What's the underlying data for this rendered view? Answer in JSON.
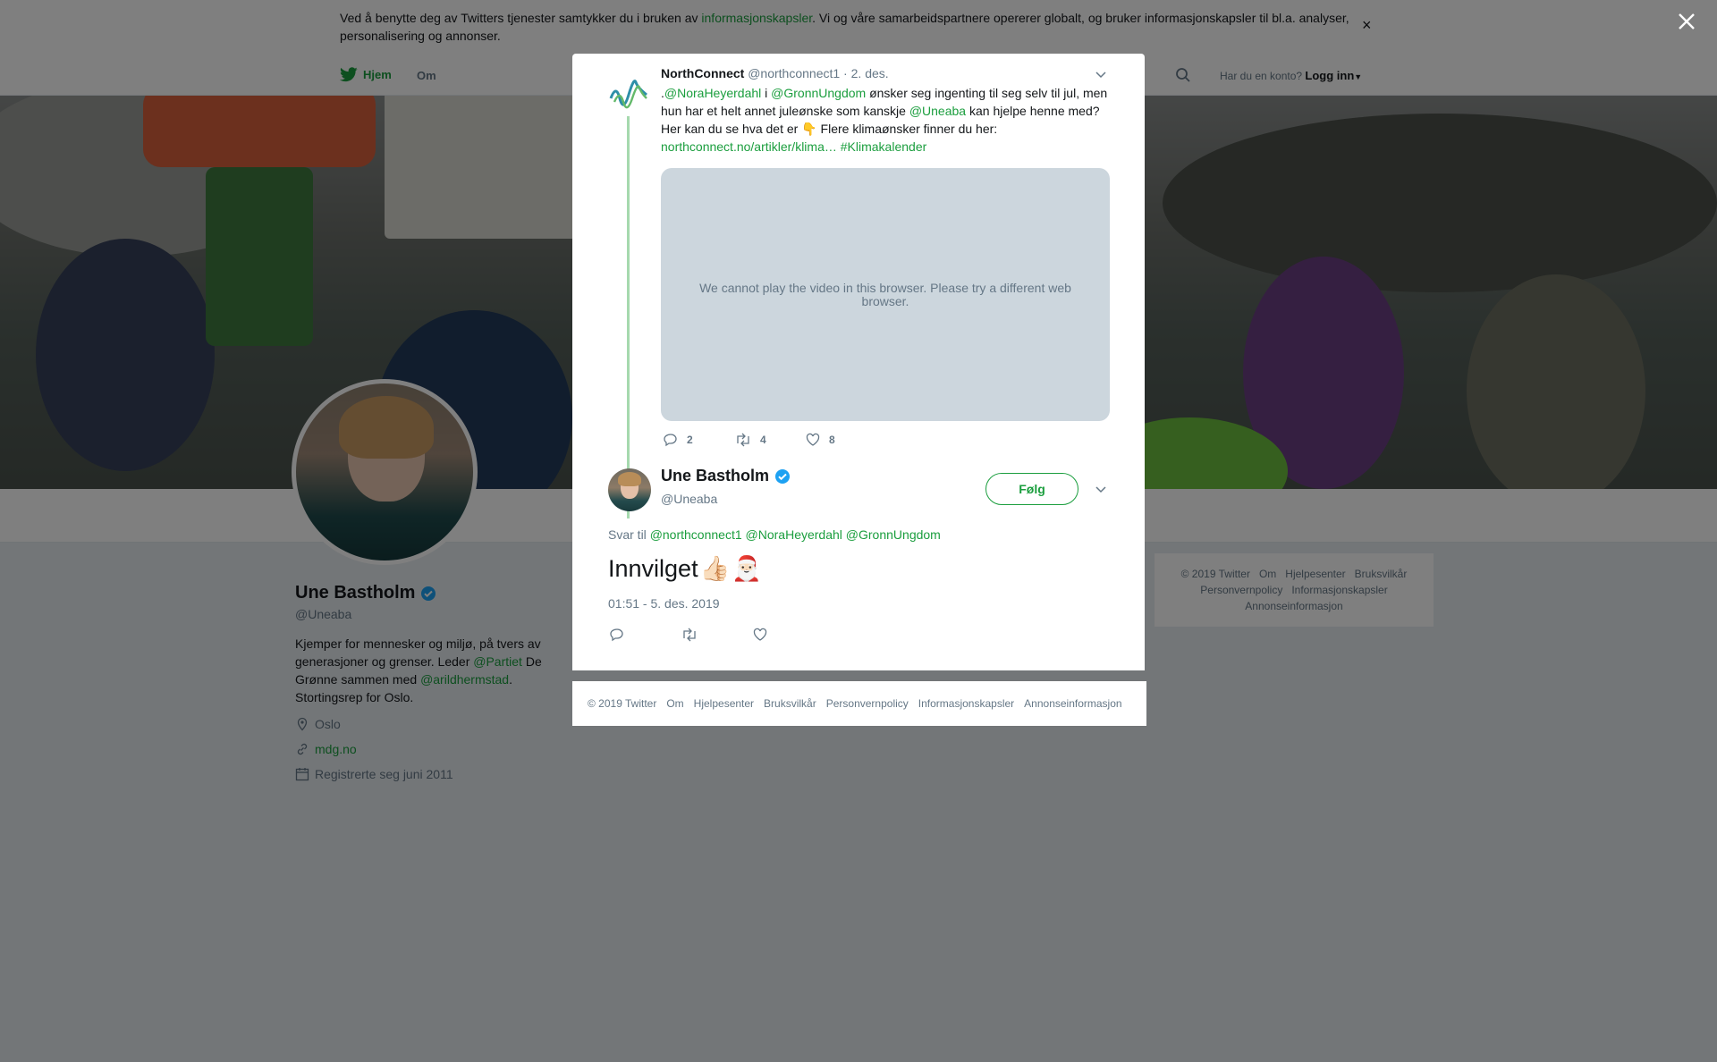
{
  "cookie": {
    "pre": "Ved å benytte deg av Twitters tjenester samtykker du i bruken av ",
    "link": "informasjonskapsler",
    "post": ". Vi og våre samarbeidspartnere opererer globalt, og bruker informasjonskapsler til bl.a. analyser, personalisering og annonser.",
    "close": "×"
  },
  "nav": {
    "home": "Hjem",
    "about": "Om",
    "account_prompt": "Har du en konto?",
    "login": "Logg inn"
  },
  "profile": {
    "name": "Une Bastholm",
    "handle": "@Uneaba",
    "bio_1": "Kjemper for mennesker og miljø, på tvers av generasjoner og grenser. Leder ",
    "bio_link_1": "@Partiet",
    "bio_2": " De Grønne sammen med ",
    "bio_link_2": "@arildhermstad",
    "bio_3": ". Stortingsrep for Oslo.",
    "location": "Oslo",
    "website": "mdg.no",
    "joined": "Registrerte seg juni 2011"
  },
  "right_footer": {
    "items": [
      "© 2019 Twitter",
      "Om",
      "Hjelpesenter",
      "Bruksvilkår",
      "Personvernpolicy",
      "Informasjonskapsler",
      "Annonseinformasjon"
    ]
  },
  "parent_tweet": {
    "name": "NorthConnect",
    "handle": "@northconnect1",
    "sep": " · ",
    "date": "2. des.",
    "t_dot": ".",
    "m1": "@NoraHeyerdahl",
    "t_i": " i ",
    "m2": "@GronnUngdom",
    "t_a": " ønsker seg ingenting til seg selv til jul, men hun har et helt annet juleønske som kanskje ",
    "m3": "@Uneaba",
    "t_b": " kan hjelpe henne med? Her kan du se hva det er ",
    "emoji": "👇",
    "t_c": " Flere klimaønsker finner du her: ",
    "url": "northconnect.no/artikler/klima…",
    "hashtag": "#Klimakalender",
    "video_message": "We cannot play the video in this browser. Please try a different web browser.",
    "replies": "2",
    "retweets": "4",
    "likes": "8"
  },
  "reply_tweet": {
    "name": "Une Bastholm",
    "handle": "@Uneaba",
    "follow": "Følg",
    "reply_to_label": "Svar til",
    "reply_mentions": [
      "@northconnect1",
      "@NoraHeyerdahl",
      "@GronnUngdom"
    ],
    "text": "Innvilget",
    "emoji_1": "👍🏻",
    "emoji_2": "🎅🏻",
    "timestamp": "01:51 - 5. des. 2019"
  },
  "modal_footer": {
    "items": [
      "© 2019 Twitter",
      "Om",
      "Hjelpesenter",
      "Bruksvilkår",
      "Personvernpolicy",
      "Informasjonskapsler",
      "Annonseinformasjon"
    ]
  },
  "colors": {
    "accent": "#1b9e3e",
    "verified": "#1da1f2",
    "muted": "#657786"
  }
}
